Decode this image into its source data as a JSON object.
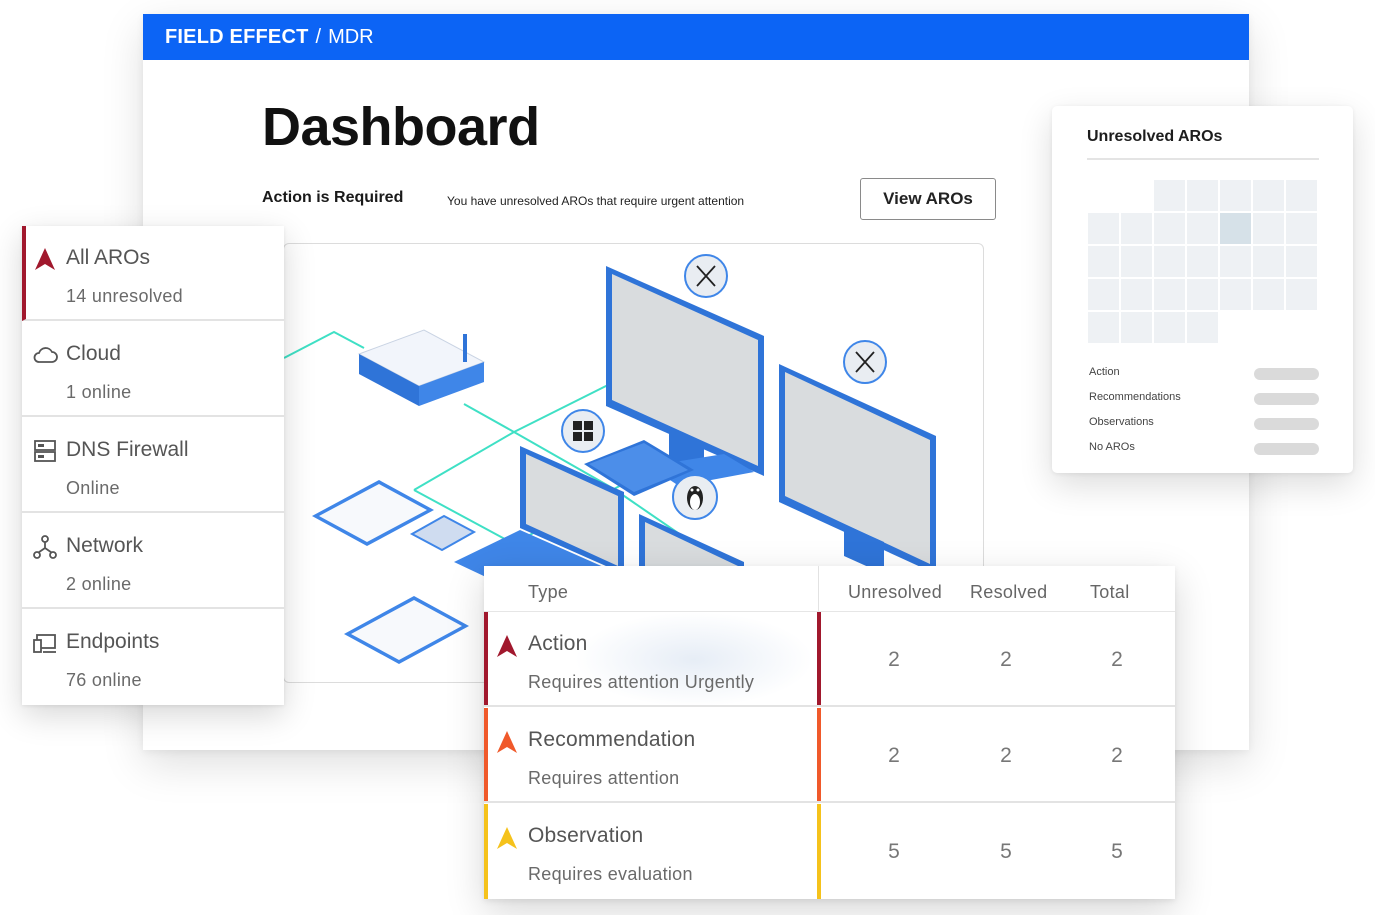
{
  "topbar": {
    "brand": "FIELD EFFECT",
    "separator": "/",
    "product": "MDR"
  },
  "page": {
    "title": "Dashboard",
    "alert_label": "Action is Required",
    "alert_text": "You have unresolved AROs that require urgent attention",
    "view_button": "View AROs"
  },
  "sidebar": {
    "items": [
      {
        "label": "All AROs",
        "sub": "14 unresolved",
        "icon": "aro-triangle-icon",
        "active": true
      },
      {
        "label": "Cloud",
        "sub": "1 online",
        "icon": "cloud-icon"
      },
      {
        "label": "DNS Firewall",
        "sub": "Online",
        "icon": "server-icon"
      },
      {
        "label": "Network",
        "sub": "2 online",
        "icon": "network-icon"
      },
      {
        "label": "Endpoints",
        "sub": "76 online",
        "icon": "endpoints-icon"
      }
    ]
  },
  "aros_card": {
    "title": "Unresolved AROs",
    "legend": [
      "Action",
      "Recommendations",
      "Observations",
      "No AROs"
    ]
  },
  "table": {
    "headers": {
      "type": "Type",
      "unresolved": "Unresolved",
      "resolved": "Resolved",
      "total": "Total"
    },
    "rows": [
      {
        "type": "Action",
        "desc": "Requires attention Urgently",
        "unresolved": "2",
        "resolved": "2",
        "total": "2",
        "color": "#a1182d"
      },
      {
        "type": "Recommendation",
        "desc": "Requires attention",
        "unresolved": "2",
        "resolved": "2",
        "total": "2",
        "color": "#f0592a"
      },
      {
        "type": "Observation",
        "desc": "Requires evaluation",
        "unresolved": "5",
        "resolved": "5",
        "total": "5",
        "color": "#f5c21b"
      }
    ]
  },
  "colors": {
    "brand_blue": "#0c64f5",
    "action": "#a1182d",
    "recommendation": "#f0592a",
    "observation": "#f5c21b",
    "device_blue": "#2f74d8",
    "connector_teal": "#3fe0c5"
  }
}
